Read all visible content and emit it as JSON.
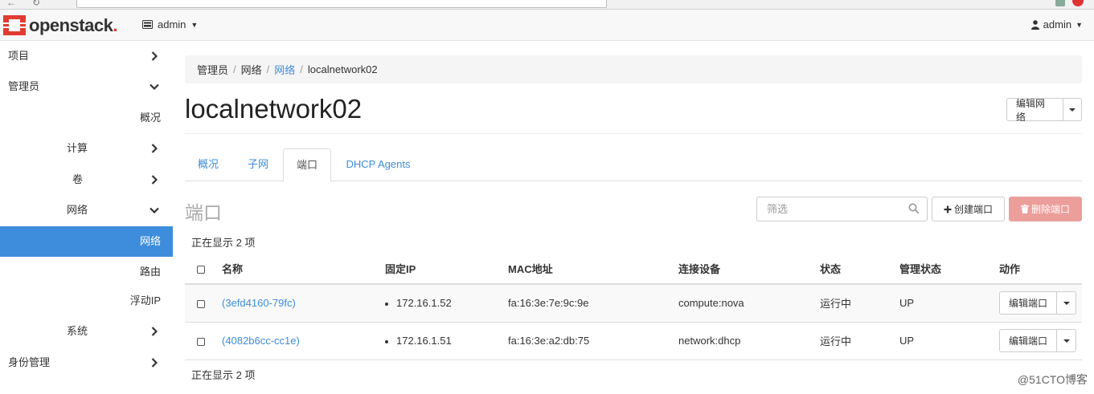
{
  "navbar": {
    "logo_text": "openstack",
    "project_label": "admin",
    "user_label": "admin"
  },
  "sidebar": {
    "items": [
      {
        "label": "项目",
        "chevron": "right"
      },
      {
        "label": "管理员",
        "chevron": "down"
      },
      {
        "label": "概况"
      },
      {
        "label": "计算",
        "chevron": "right"
      },
      {
        "label": "卷",
        "chevron": "right"
      },
      {
        "label": "网络",
        "chevron": "down"
      },
      {
        "label": "网络",
        "active": true
      },
      {
        "label": "路由"
      },
      {
        "label": "浮动IP"
      },
      {
        "label": "系统",
        "chevron": "right"
      },
      {
        "label": "身份管理",
        "chevron": "right"
      }
    ]
  },
  "breadcrumb": {
    "items": [
      "管理员",
      "网络",
      "网络",
      "localnetwork02"
    ]
  },
  "page": {
    "title": "localnetwork02",
    "edit_network_label": "编辑网络"
  },
  "tabs": [
    {
      "label": "概况"
    },
    {
      "label": "子网"
    },
    {
      "label": "端口",
      "active": true
    },
    {
      "label": "DHCP Agents"
    }
  ],
  "ports": {
    "section_title": "端口",
    "filter_placeholder": "筛选",
    "create_label": "创建端口",
    "delete_label": "删除端口",
    "count_text": "正在显示 2 项",
    "columns": [
      "名称",
      "固定IP",
      "MAC地址",
      "连接设备",
      "状态",
      "管理状态",
      "动作"
    ],
    "rows": [
      {
        "name": "(3efd4160-79fc)",
        "ip": "172.16.1.52",
        "mac": "fa:16:3e:7e:9c:9e",
        "device": "compute:nova",
        "status": "运行中",
        "admin_state": "UP",
        "action": "编辑端口"
      },
      {
        "name": "(4082b6cc-cc1e)",
        "ip": "172.16.1.51",
        "mac": "fa:16:3e:a2:db:75",
        "device": "network:dhcp",
        "status": "运行中",
        "admin_state": "UP",
        "action": "编辑端口"
      }
    ]
  },
  "watermark": "@51CTO博客",
  "colors": {
    "accent": "#3e8ddd",
    "brand_red": "#e03c31",
    "danger_disabled": "#ec9e9b"
  }
}
